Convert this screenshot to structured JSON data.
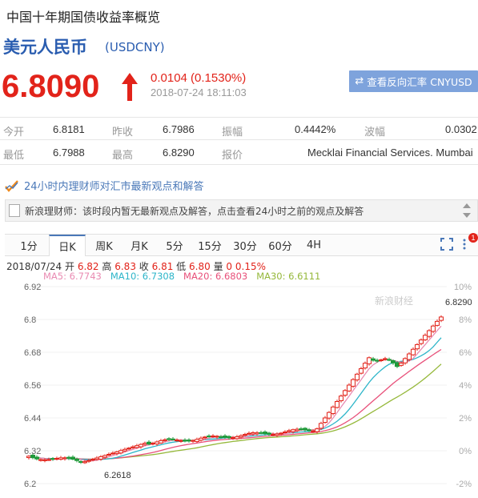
{
  "header": {
    "title": "中国十年期国债收益率概览",
    "pair_name": "美元人民币",
    "pair_code": "(USDCNY)"
  },
  "quote": {
    "price": "6.8090",
    "change": "0.0104 (0.1530%)",
    "timestamp": "2018-07-24 18:11:03",
    "direction": "up",
    "up_color": "#e2231a"
  },
  "swap_button": {
    "icon": "swap-arrows-icon",
    "label": "查看反向汇率 CNYUSD"
  },
  "stats": [
    {
      "label": "今开",
      "value": "6.8181"
    },
    {
      "label": "昨收",
      "value": "6.7986"
    },
    {
      "label": "振幅",
      "value": "0.4442%"
    },
    {
      "label": "波幅",
      "value": "0.0302"
    },
    {
      "label": "最低",
      "value": "6.7988"
    },
    {
      "label": "最高",
      "value": "6.8290"
    },
    {
      "label": "报价",
      "value": "Mecklai Financial Services. Mumbai"
    }
  ],
  "advisor": {
    "link": "24小时内理财师对汇市最新观点和解答",
    "notice": "新浪理财师：该时段内暂无最新观点及解答，点击查看24小时之前的观点及解答"
  },
  "tabs": [
    "1分",
    "日K",
    "周K",
    "月K",
    "5分",
    "15分",
    "30分",
    "60分",
    "4H"
  ],
  "active_tab": "日K",
  "chart_tools": {
    "fullscreen_icon": "fullscreen-icon",
    "more_icon": "more-vert-icon",
    "badge": "1"
  },
  "ohlc": {
    "date": "2018/07/24",
    "open_label": "开",
    "open": "6.82",
    "high_label": "高",
    "high": "6.83",
    "close_label": "收",
    "close": "6.81",
    "low_label": "低",
    "low": "6.80",
    "vol_label": "量",
    "vol": "0",
    "chg": "0.15%"
  },
  "ma": [
    {
      "label": "MA5: 6.7743",
      "color": "#e98bb2"
    },
    {
      "label": "MA10: 6.7308",
      "color": "#2cb5c9"
    },
    {
      "label": "MA20: 6.6803",
      "color": "#e8507a"
    },
    {
      "label": "MA30: 6.6111",
      "color": "#95b83a"
    }
  ],
  "watermark": "新浪财经",
  "chart_data": {
    "type": "candlestick",
    "y_ticks": [
      "6.92",
      "6.8",
      "6.68",
      "6.56",
      "6.44",
      "6.32",
      "6.2"
    ],
    "pct_ticks": [
      "10%",
      "8%",
      "6%",
      "4%",
      "2%",
      "0%",
      "-2%"
    ],
    "ylim": [
      6.2,
      6.92
    ],
    "annotations": {
      "max": "6.8290",
      "min": "6.2618"
    },
    "up_color": "#e2231a",
    "down_color": "#1f9a3a"
  }
}
